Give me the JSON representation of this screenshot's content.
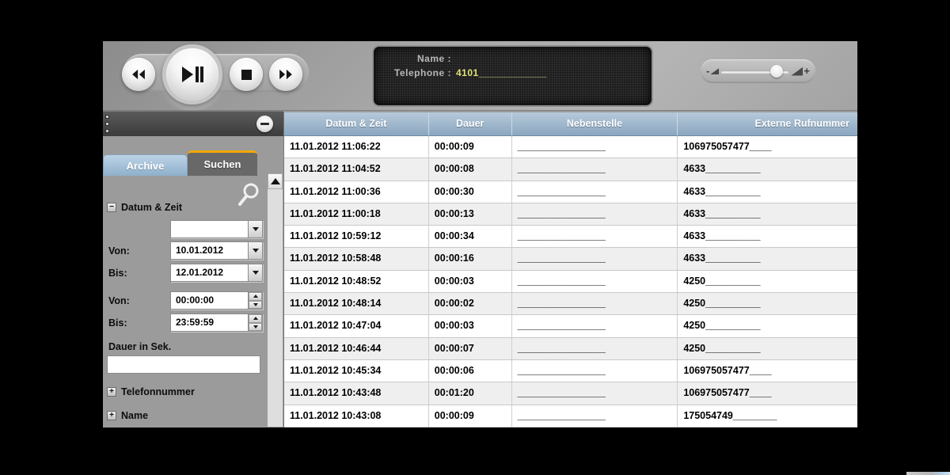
{
  "player": {
    "display": {
      "name_label": "Name :",
      "name_value": "",
      "telephone_label": "Telephone :",
      "telephone_value": "4101____________",
      "value_color": "#e2e27a"
    },
    "volume": {
      "minus_label": "-",
      "plus_label": "+"
    }
  },
  "sidebar": {
    "tabs": {
      "archive": "Archive",
      "suchen": "Suchen"
    },
    "active_tab": "Suchen",
    "accent_color": "#f5a800",
    "datum_zeit": {
      "expander": "−",
      "label": "Datum & Zeit",
      "filter_dropdown_value": "",
      "date_von_label": "Von:",
      "date_von_value": "10.01.2012",
      "date_bis_label": "Bis:",
      "date_bis_value": "12.01.2012",
      "time_von_label": "Von:",
      "time_von_value": "00:00:00",
      "time_bis_label": "Bis:",
      "time_bis_value": "23:59:59"
    },
    "dauer": {
      "label": "Dauer in Sek.",
      "value": ""
    },
    "telefonnummer": {
      "expander": "+",
      "label": "Telefonnummer"
    },
    "name": {
      "expander": "+",
      "label": "Name"
    }
  },
  "table": {
    "header_color": "#8ba7c0",
    "columns": [
      "Datum & Zeit",
      "Dauer",
      "Nebenstelle",
      "Externe Rufnummer"
    ],
    "rows": [
      {
        "datetime": "11.01.2012 11:06:22",
        "dauer": "00:00:09",
        "nebenstelle": "________________",
        "extern": "106975057477____"
      },
      {
        "datetime": "11.01.2012 11:04:52",
        "dauer": "00:00:08",
        "nebenstelle": "________________",
        "extern": "4633__________"
      },
      {
        "datetime": "11.01.2012 11:00:36",
        "dauer": "00:00:30",
        "nebenstelle": "________________",
        "extern": "4633__________"
      },
      {
        "datetime": "11.01.2012 11:00:18",
        "dauer": "00:00:13",
        "nebenstelle": "________________",
        "extern": "4633__________"
      },
      {
        "datetime": "11.01.2012 10:59:12",
        "dauer": "00:00:34",
        "nebenstelle": "________________",
        "extern": "4633__________"
      },
      {
        "datetime": "11.01.2012 10:58:48",
        "dauer": "00:00:16",
        "nebenstelle": "________________",
        "extern": "4633__________"
      },
      {
        "datetime": "11.01.2012 10:48:52",
        "dauer": "00:00:03",
        "nebenstelle": "________________",
        "extern": "4250__________"
      },
      {
        "datetime": "11.01.2012 10:48:14",
        "dauer": "00:00:02",
        "nebenstelle": "________________",
        "extern": "4250__________"
      },
      {
        "datetime": "11.01.2012 10:47:04",
        "dauer": "00:00:03",
        "nebenstelle": "________________",
        "extern": "4250__________"
      },
      {
        "datetime": "11.01.2012 10:46:44",
        "dauer": "00:00:07",
        "nebenstelle": "________________",
        "extern": "4250__________"
      },
      {
        "datetime": "11.01.2012 10:45:34",
        "dauer": "00:00:06",
        "nebenstelle": "________________",
        "extern": "106975057477____"
      },
      {
        "datetime": "11.01.2012 10:43:48",
        "dauer": "00:01:20",
        "nebenstelle": "________________",
        "extern": "106975057477____"
      },
      {
        "datetime": "11.01.2012 10:43:08",
        "dauer": "00:00:09",
        "nebenstelle": "________________",
        "extern": "175054749________"
      }
    ]
  }
}
